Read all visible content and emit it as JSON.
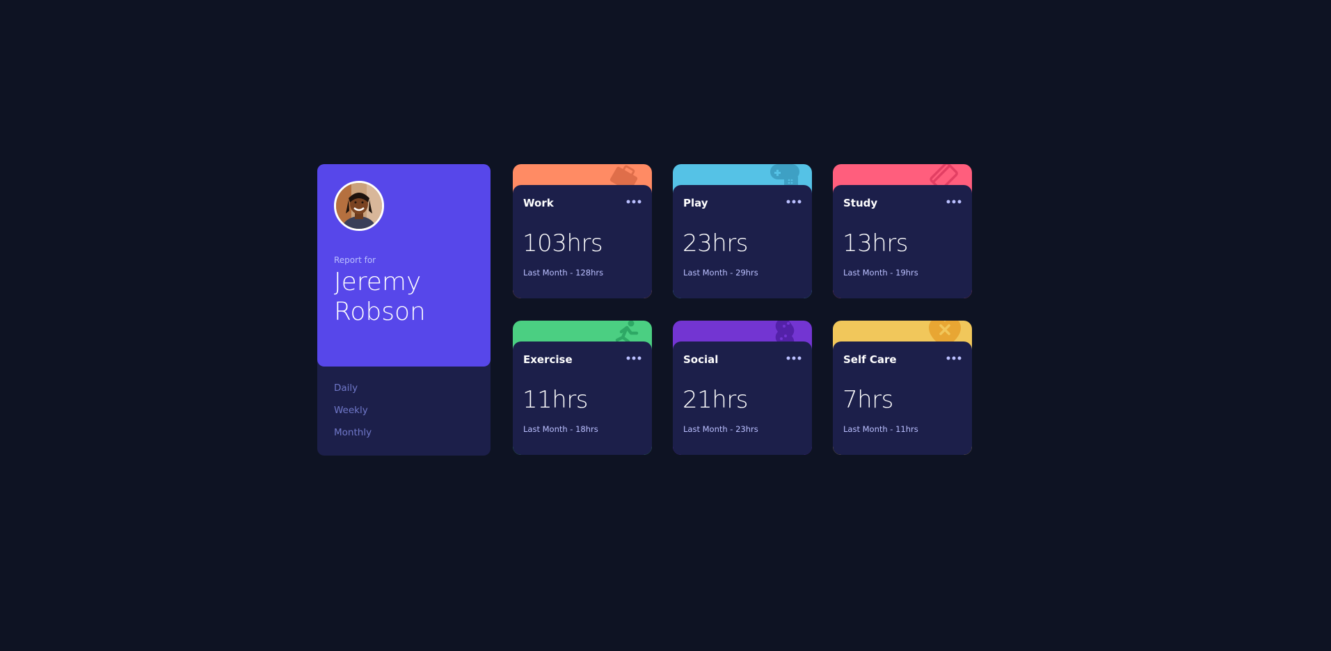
{
  "profile": {
    "report_label": "Report for",
    "name": "Jeremy Robson",
    "avatar_icon": "user-avatar-photo"
  },
  "timeframes": [
    "Daily",
    "Weekly",
    "Monthly"
  ],
  "activities": [
    {
      "title": "Work",
      "current": "103hrs",
      "previous": "Last Month - 128hrs",
      "color": "#ff8b64",
      "icon": "briefcase-icon"
    },
    {
      "title": "Play",
      "current": "23hrs",
      "previous": "Last Month - 29hrs",
      "color": "#55c2e6",
      "icon": "gamepad-icon"
    },
    {
      "title": "Study",
      "current": "13hrs",
      "previous": "Last Month - 19hrs",
      "color": "#ff5e7d",
      "icon": "book-icon"
    },
    {
      "title": "Exercise",
      "current": "11hrs",
      "previous": "Last Month - 18hrs",
      "color": "#4bcf82",
      "icon": "running-icon"
    },
    {
      "title": "Social",
      "current": "21hrs",
      "previous": "Last Month - 23hrs",
      "color": "#7335d2",
      "icon": "social-icon"
    },
    {
      "title": "Self Care",
      "current": "7hrs",
      "previous": "Last Month - 11hrs",
      "color": "#f1c75b",
      "icon": "self-care-icon"
    }
  ],
  "colors": {
    "background": "#0e1323",
    "card": "#1c1f4a",
    "profile_accent": "#5747ea"
  }
}
